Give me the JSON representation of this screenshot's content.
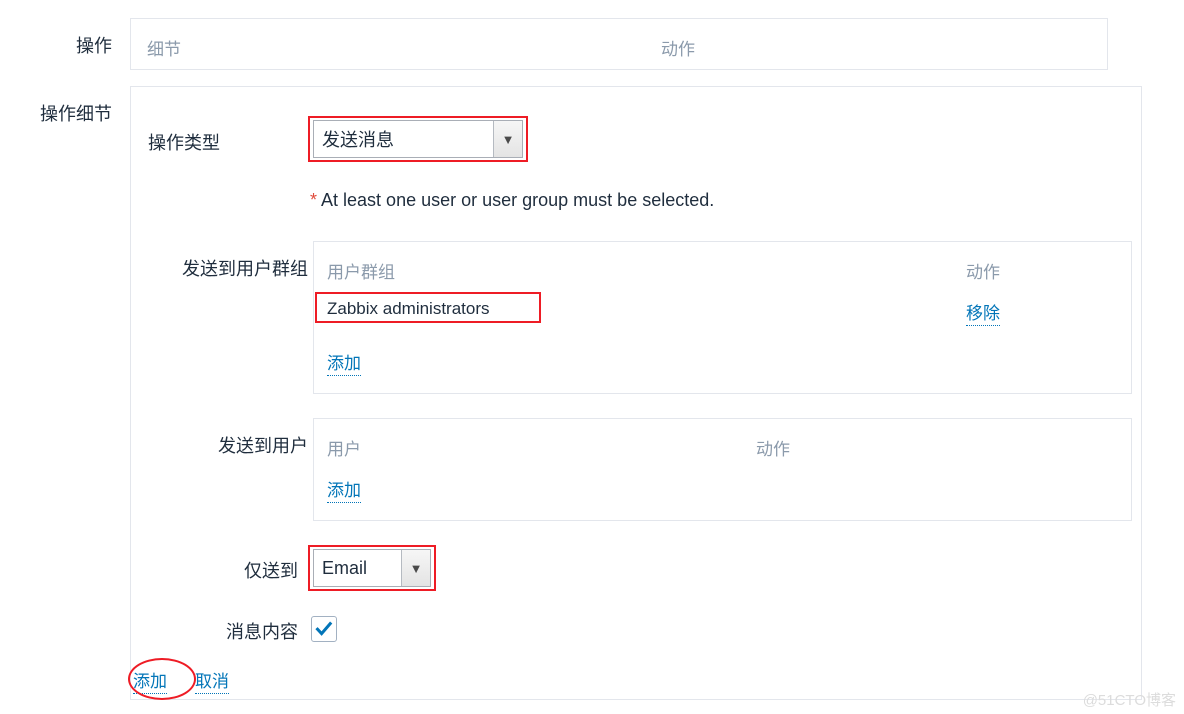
{
  "operation_section": {
    "label": "操作",
    "table_headers": {
      "details": "细节",
      "action": "动作"
    }
  },
  "operation_details_section": {
    "label": "操作细节",
    "operation_type": {
      "label": "操作类型",
      "selected_value": "发送消息",
      "arrow_icon": "chevron-down-icon",
      "highlight_color": "#ee1c25"
    },
    "required_note": {
      "marker": "*",
      "text": "At least one user or user group must be selected.",
      "marker_color": "#e04b3c"
    },
    "send_to_user_groups": {
      "label": "发送到用户群组",
      "headers": {
        "name": "用户群组",
        "action": "动作"
      },
      "rows": [
        {
          "name": "Zabbix administrators",
          "action_label": "移除"
        }
      ],
      "add_label": "添加"
    },
    "send_to_users": {
      "label": "发送到用户",
      "headers": {
        "name": "用户",
        "action": "动作"
      },
      "rows": [],
      "add_label": "添加"
    },
    "send_only_to": {
      "label": "仅送到",
      "selected_value": "Email",
      "arrow_icon": "chevron-down-icon"
    },
    "message_content": {
      "label": "消息内容",
      "checked": true,
      "check_icon": "checkmark-icon",
      "check_color": "#0275b8"
    },
    "footer": {
      "add_label": "添加",
      "cancel_label": "取消"
    }
  },
  "watermark": "@51CTO博客",
  "theme": {
    "link_color": "#0275b8",
    "muted_color": "#8b9aab",
    "border_color": "#e3e6ec",
    "text_color": "#1f2d3d",
    "accent_red": "#ee1c25"
  }
}
